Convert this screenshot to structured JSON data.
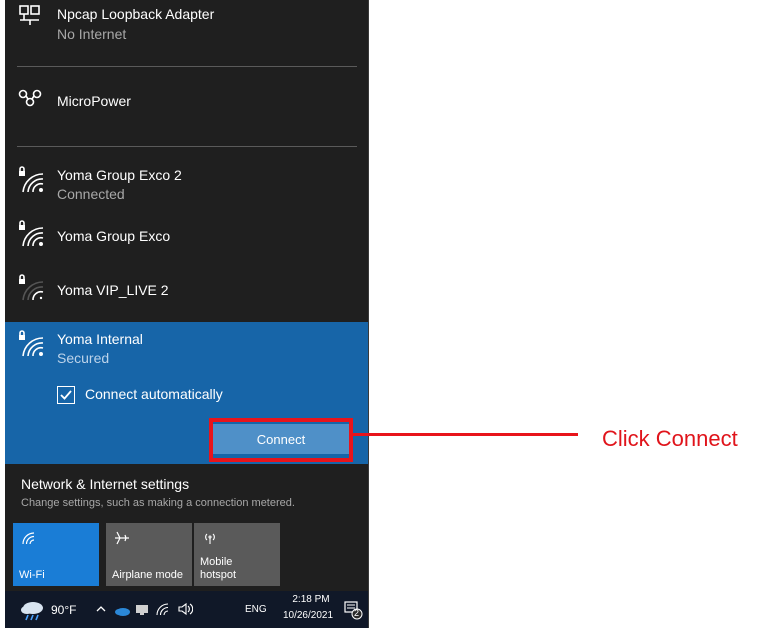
{
  "networks": [
    {
      "name": "Npcap Loopback Adapter",
      "status": "No Internet",
      "icon": "ethernet-icon"
    },
    {
      "name": "MicroPower",
      "status": "",
      "icon": "cellular-icon"
    },
    {
      "name": "Yoma Group Exco 2",
      "status": "Connected",
      "icon": "wifi-lock-icon"
    },
    {
      "name": "Yoma Group Exco",
      "status": "",
      "icon": "wifi-lock-icon"
    },
    {
      "name": "Yoma VIP_LIVE 2",
      "status": "",
      "icon": "wifi-lock-weak-icon"
    }
  ],
  "selected": {
    "name": "Yoma Internal",
    "status": "Secured",
    "auto_label": "Connect automatically",
    "auto_checked": true,
    "connect_label": "Connect"
  },
  "callout": {
    "text": "Click Connect",
    "color": "#e8141b"
  },
  "settings": {
    "title": "Network & Internet settings",
    "description": "Change settings, such as making a connection metered."
  },
  "tiles": [
    {
      "label": "Wi-Fi",
      "icon": "wifi-icon",
      "active": true
    },
    {
      "label": "Airplane mode",
      "icon": "airplane-icon",
      "active": false
    },
    {
      "label": "Mobile\nhotspot",
      "icon": "hotspot-icon",
      "active": false
    }
  ],
  "taskbar": {
    "temperature": "90°F",
    "language": "ENG",
    "time": "2:18 PM",
    "date": "10/26/2021",
    "notifications": "2"
  },
  "colors": {
    "accent": "#1765a8",
    "active_tile": "#1a7dd6",
    "panel_bg": "#1f1f1f"
  }
}
